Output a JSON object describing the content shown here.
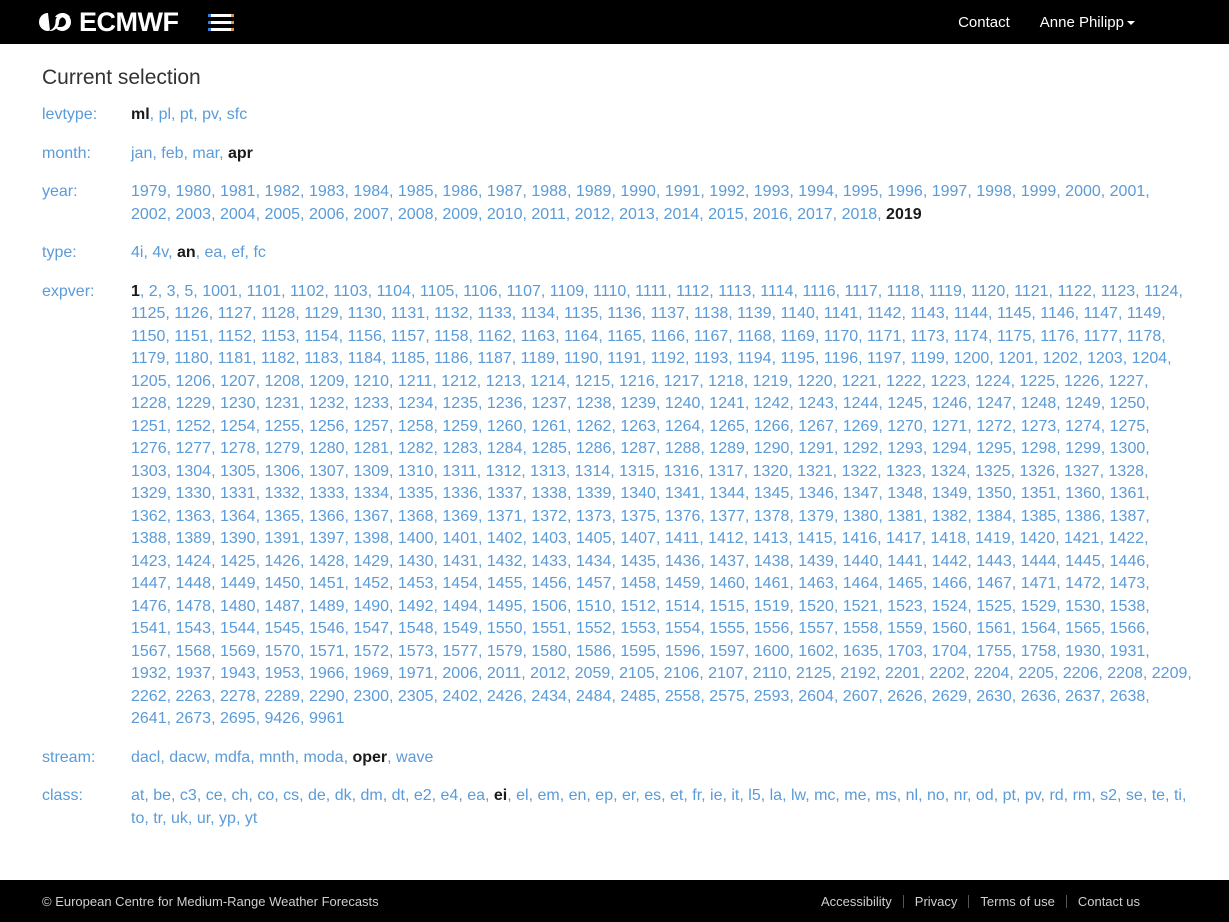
{
  "header": {
    "brand_text": "ECMWF",
    "menu_icon": "hamburger-icon",
    "links": [
      {
        "label": "Contact",
        "has_caret": false
      },
      {
        "label": "Anne Philipp",
        "has_caret": true
      }
    ]
  },
  "main": {
    "page_title": "Current selection",
    "rows": [
      {
        "label": "levtype",
        "values": [
          "ml",
          "pl",
          "pt",
          "pv",
          "sfc"
        ],
        "selected": [
          "ml"
        ]
      },
      {
        "label": "month",
        "values": [
          "jan",
          "feb",
          "mar",
          "apr"
        ],
        "selected": [
          "apr"
        ]
      },
      {
        "label": "year",
        "values": [
          "1979",
          "1980",
          "1981",
          "1982",
          "1983",
          "1984",
          "1985",
          "1986",
          "1987",
          "1988",
          "1989",
          "1990",
          "1991",
          "1992",
          "1993",
          "1994",
          "1995",
          "1996",
          "1997",
          "1998",
          "1999",
          "2000",
          "2001",
          "2002",
          "2003",
          "2004",
          "2005",
          "2006",
          "2007",
          "2008",
          "2009",
          "2010",
          "2011",
          "2012",
          "2013",
          "2014",
          "2015",
          "2016",
          "2017",
          "2018",
          "2019"
        ],
        "selected": [
          "2019"
        ]
      },
      {
        "label": "type",
        "values": [
          "4i",
          "4v",
          "an",
          "ea",
          "ef",
          "fc"
        ],
        "selected": [
          "an"
        ]
      },
      {
        "label": "expver",
        "values": [
          "1",
          "2",
          "3",
          "5",
          "1001",
          "1101",
          "1102",
          "1103",
          "1104",
          "1105",
          "1106",
          "1107",
          "1109",
          "1110",
          "1111",
          "1112",
          "1113",
          "1114",
          "1116",
          "1117",
          "1118",
          "1119",
          "1120",
          "1121",
          "1122",
          "1123",
          "1124",
          "1125",
          "1126",
          "1127",
          "1128",
          "1129",
          "1130",
          "1131",
          "1132",
          "1133",
          "1134",
          "1135",
          "1136",
          "1137",
          "1138",
          "1139",
          "1140",
          "1141",
          "1142",
          "1143",
          "1144",
          "1145",
          "1146",
          "1147",
          "1149",
          "1150",
          "1151",
          "1152",
          "1153",
          "1154",
          "1156",
          "1157",
          "1158",
          "1162",
          "1163",
          "1164",
          "1165",
          "1166",
          "1167",
          "1168",
          "1169",
          "1170",
          "1171",
          "1173",
          "1174",
          "1175",
          "1176",
          "1177",
          "1178",
          "1179",
          "1180",
          "1181",
          "1182",
          "1183",
          "1184",
          "1185",
          "1186",
          "1187",
          "1189",
          "1190",
          "1191",
          "1192",
          "1193",
          "1194",
          "1195",
          "1196",
          "1197",
          "1199",
          "1200",
          "1201",
          "1202",
          "1203",
          "1204",
          "1205",
          "1206",
          "1207",
          "1208",
          "1209",
          "1210",
          "1211",
          "1212",
          "1213",
          "1214",
          "1215",
          "1216",
          "1217",
          "1218",
          "1219",
          "1220",
          "1221",
          "1222",
          "1223",
          "1224",
          "1225",
          "1226",
          "1227",
          "1228",
          "1229",
          "1230",
          "1231",
          "1232",
          "1233",
          "1234",
          "1235",
          "1236",
          "1237",
          "1238",
          "1239",
          "1240",
          "1241",
          "1242",
          "1243",
          "1244",
          "1245",
          "1246",
          "1247",
          "1248",
          "1249",
          "1250",
          "1251",
          "1252",
          "1254",
          "1255",
          "1256",
          "1257",
          "1258",
          "1259",
          "1260",
          "1261",
          "1262",
          "1263",
          "1264",
          "1265",
          "1266",
          "1267",
          "1269",
          "1270",
          "1271",
          "1272",
          "1273",
          "1274",
          "1275",
          "1276",
          "1277",
          "1278",
          "1279",
          "1280",
          "1281",
          "1282",
          "1283",
          "1284",
          "1285",
          "1286",
          "1287",
          "1288",
          "1289",
          "1290",
          "1291",
          "1292",
          "1293",
          "1294",
          "1295",
          "1298",
          "1299",
          "1300",
          "1303",
          "1304",
          "1305",
          "1306",
          "1307",
          "1309",
          "1310",
          "1311",
          "1312",
          "1313",
          "1314",
          "1315",
          "1316",
          "1317",
          "1320",
          "1321",
          "1322",
          "1323",
          "1324",
          "1325",
          "1326",
          "1327",
          "1328",
          "1329",
          "1330",
          "1331",
          "1332",
          "1333",
          "1334",
          "1335",
          "1336",
          "1337",
          "1338",
          "1339",
          "1340",
          "1341",
          "1344",
          "1345",
          "1346",
          "1347",
          "1348",
          "1349",
          "1350",
          "1351",
          "1360",
          "1361",
          "1362",
          "1363",
          "1364",
          "1365",
          "1366",
          "1367",
          "1368",
          "1369",
          "1371",
          "1372",
          "1373",
          "1375",
          "1376",
          "1377",
          "1378",
          "1379",
          "1380",
          "1381",
          "1382",
          "1384",
          "1385",
          "1386",
          "1387",
          "1388",
          "1389",
          "1390",
          "1391",
          "1397",
          "1398",
          "1400",
          "1401",
          "1402",
          "1403",
          "1405",
          "1407",
          "1411",
          "1412",
          "1413",
          "1415",
          "1416",
          "1417",
          "1418",
          "1419",
          "1420",
          "1421",
          "1422",
          "1423",
          "1424",
          "1425",
          "1426",
          "1428",
          "1429",
          "1430",
          "1431",
          "1432",
          "1433",
          "1434",
          "1435",
          "1436",
          "1437",
          "1438",
          "1439",
          "1440",
          "1441",
          "1442",
          "1443",
          "1444",
          "1445",
          "1446",
          "1447",
          "1448",
          "1449",
          "1450",
          "1451",
          "1452",
          "1453",
          "1454",
          "1455",
          "1456",
          "1457",
          "1458",
          "1459",
          "1460",
          "1461",
          "1463",
          "1464",
          "1465",
          "1466",
          "1467",
          "1471",
          "1472",
          "1473",
          "1476",
          "1478",
          "1480",
          "1487",
          "1489",
          "1490",
          "1492",
          "1494",
          "1495",
          "1506",
          "1510",
          "1512",
          "1514",
          "1515",
          "1519",
          "1520",
          "1521",
          "1523",
          "1524",
          "1525",
          "1529",
          "1530",
          "1538",
          "1541",
          "1543",
          "1544",
          "1545",
          "1546",
          "1547",
          "1548",
          "1549",
          "1550",
          "1551",
          "1552",
          "1553",
          "1554",
          "1555",
          "1556",
          "1557",
          "1558",
          "1559",
          "1560",
          "1561",
          "1564",
          "1565",
          "1566",
          "1567",
          "1568",
          "1569",
          "1570",
          "1571",
          "1572",
          "1573",
          "1577",
          "1579",
          "1580",
          "1586",
          "1595",
          "1596",
          "1597",
          "1600",
          "1602",
          "1635",
          "1703",
          "1704",
          "1755",
          "1758",
          "1930",
          "1931",
          "1932",
          "1937",
          "1943",
          "1953",
          "1966",
          "1969",
          "1971",
          "2006",
          "2011",
          "2012",
          "2059",
          "2105",
          "2106",
          "2107",
          "2110",
          "2125",
          "2192",
          "2201",
          "2202",
          "2204",
          "2205",
          "2206",
          "2208",
          "2209",
          "2262",
          "2263",
          "2278",
          "2289",
          "2290",
          "2300",
          "2305",
          "2402",
          "2426",
          "2434",
          "2484",
          "2485",
          "2558",
          "2575",
          "2593",
          "2604",
          "2607",
          "2626",
          "2629",
          "2630",
          "2636",
          "2637",
          "2638",
          "2641",
          "2673",
          "2695",
          "9426",
          "9961"
        ],
        "selected": [
          "1"
        ]
      },
      {
        "label": "stream",
        "values": [
          "dacl",
          "dacw",
          "mdfa",
          "mnth",
          "moda",
          "oper",
          "wave"
        ],
        "selected": [
          "oper"
        ]
      },
      {
        "label": "class",
        "values": [
          "at",
          "be",
          "c3",
          "ce",
          "ch",
          "co",
          "cs",
          "de",
          "dk",
          "dm",
          "dt",
          "e2",
          "e4",
          "ea",
          "ei",
          "el",
          "em",
          "en",
          "ep",
          "er",
          "es",
          "et",
          "fr",
          "ie",
          "it",
          "l5",
          "la",
          "lw",
          "mc",
          "me",
          "ms",
          "nl",
          "no",
          "nr",
          "od",
          "pt",
          "pv",
          "rd",
          "rm",
          "s2",
          "se",
          "te",
          "ti",
          "to",
          "tr",
          "uk",
          "ur",
          "yp",
          "yt"
        ],
        "selected": [
          "ei"
        ]
      }
    ]
  },
  "footer": {
    "copyright": "© European Centre for Medium-Range Weather Forecasts",
    "links": [
      "Accessibility",
      "Privacy",
      "Terms of use",
      "Contact us"
    ]
  },
  "colors": {
    "link_blue": "#5a9bd8",
    "header_bg": "#000000",
    "selected_text": "#1a1a1a",
    "accent_orange": "#e8903a"
  }
}
